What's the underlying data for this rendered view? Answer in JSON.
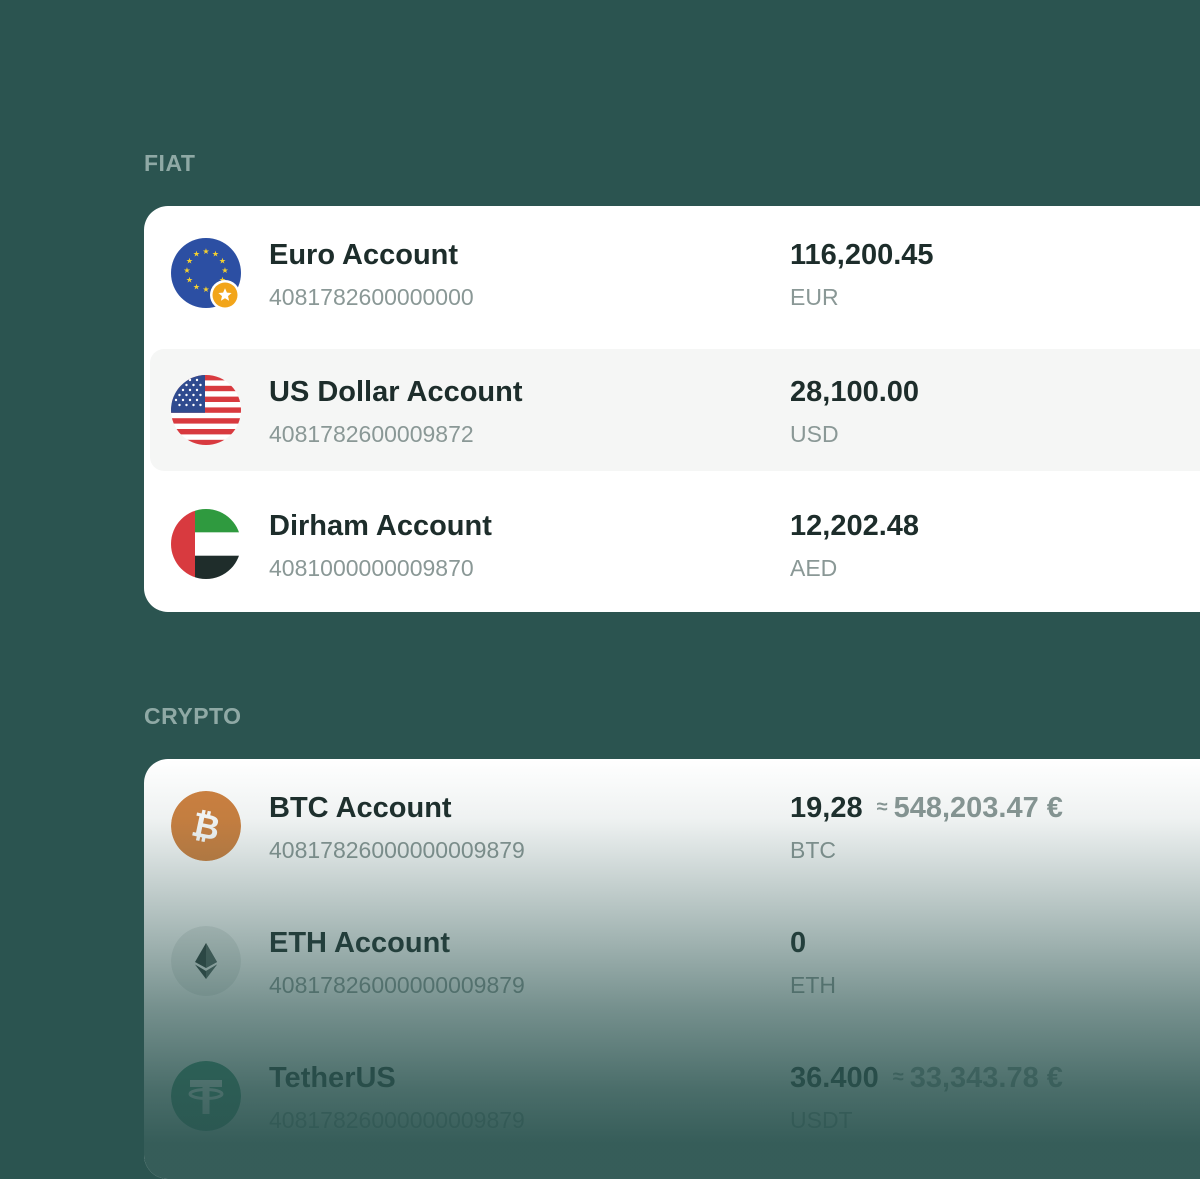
{
  "sections": {
    "fiat": {
      "label": "FIAT",
      "accounts": [
        {
          "name": "Euro Account",
          "number": "4081782600000000",
          "amount": "116,200.45",
          "currency": "EUR",
          "icon": "eu-flag-icon"
        },
        {
          "name": "US Dollar Account",
          "number": "4081782600009872",
          "amount": "28,100.00",
          "currency": "USD",
          "icon": "us-flag-icon"
        },
        {
          "name": "Dirham Account",
          "number": "4081000000009870",
          "amount": "12,202.48",
          "currency": "AED",
          "icon": "uae-flag-icon"
        }
      ]
    },
    "crypto": {
      "label": "CRYPTO",
      "accounts": [
        {
          "name": "BTC Account",
          "number": "40817826000000009879",
          "amount": "19,28",
          "approx": "≈",
          "converted": "548,203.47 €",
          "currency": "BTC",
          "icon": "bitcoin-icon"
        },
        {
          "name": "ETH Account",
          "number": "40817826000000009879",
          "amount": "0",
          "currency": "ETH",
          "icon": "ethereum-icon"
        },
        {
          "name": "TetherUS",
          "number": "40817826000000009879",
          "amount": "36.400",
          "approx": "≈",
          "converted": "33,343.78 €",
          "currency": "USDT",
          "icon": "tether-icon"
        }
      ]
    }
  },
  "colors": {
    "background": "#2b5450",
    "card": "#ffffff",
    "text_primary": "#1d2d2b",
    "text_secondary": "#8a9896",
    "bitcoin": "#d0813f",
    "tether": "#2f8a6b",
    "eu_blue": "#2c4fa3",
    "eu_star_badge": "#f2a51a"
  }
}
